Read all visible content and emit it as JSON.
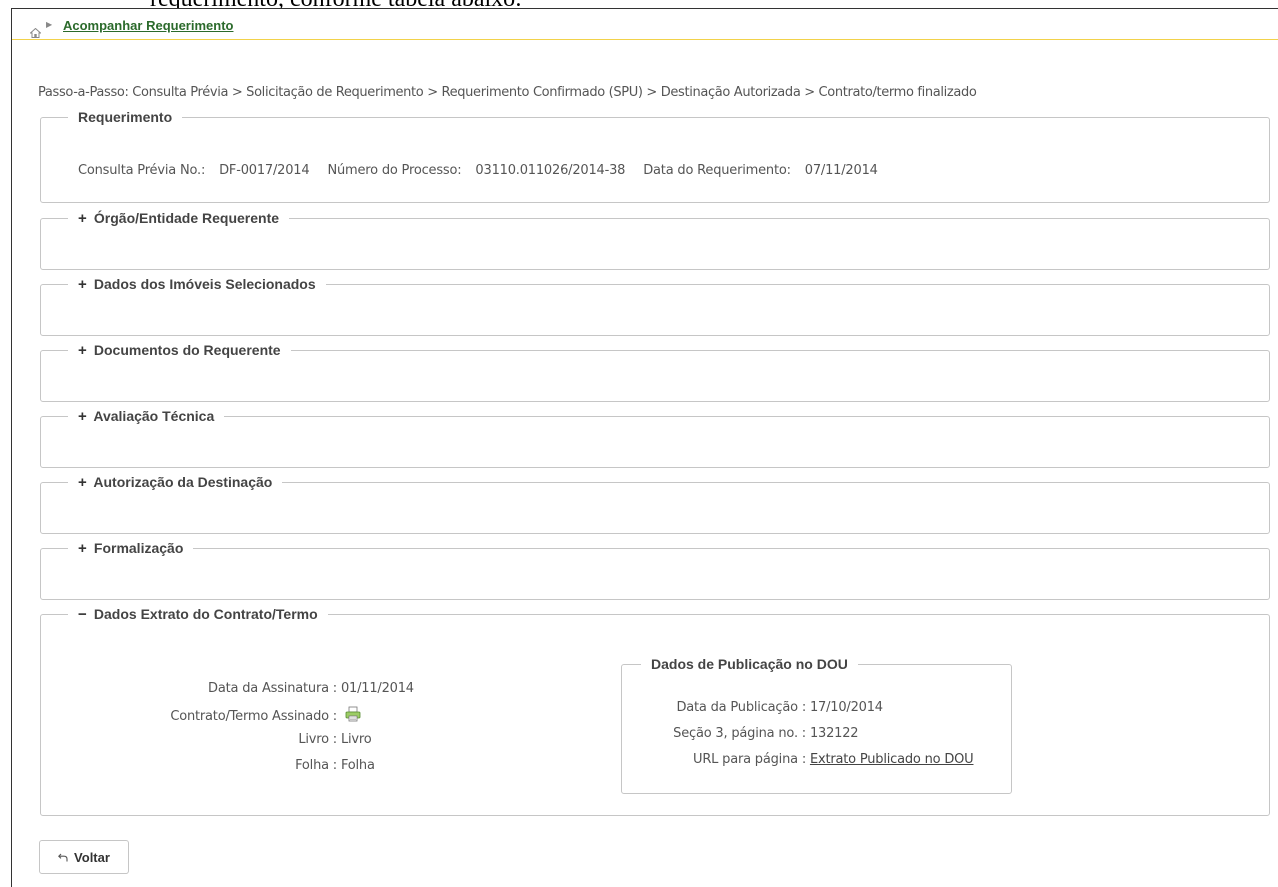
{
  "clipped_text": "requerimento, conforme tabela abaixo:",
  "breadcrumb": {
    "link": "Acompanhar Requerimento"
  },
  "steps": "Passo-a-Passo: Consulta Prévia > Solicitação de Requerimento > Requerimento Confirmado (SPU) > Destinação Autorizada > Contrato/termo finalizado",
  "requerimento": {
    "title": "Requerimento",
    "consulta_label": "Consulta Prévia No.:",
    "consulta_value": "DF-0017/2014",
    "processo_label": "Número do Processo:",
    "processo_value": "03110.011026/2014-38",
    "data_label": "Data do Requerimento:",
    "data_value": "07/11/2014"
  },
  "sections": {
    "orgao": "Órgão/Entidade Requerente",
    "imoveis": "Dados dos Imóveis Selecionados",
    "documentos": "Documentos do Requerente",
    "avaliacao": "Avaliação Técnica",
    "autorizacao": "Autorização da Destinação",
    "formalizacao": "Formalização",
    "extrato": "Dados Extrato do Contrato/Termo"
  },
  "extrato": {
    "assinatura_label": "Data da Assinatura :",
    "assinatura_value": "01/11/2014",
    "contrato_label": "Contrato/Termo Assinado :",
    "livro_label": "Livro :",
    "livro_value": "Livro",
    "folha_label": "Folha :",
    "folha_value": "Folha"
  },
  "dou": {
    "title": "Dados de Publicação no DOU",
    "data_label": "Data da Publicação :",
    "data_value": "17/10/2014",
    "secao_label": "Seção 3, página no. :",
    "secao_value": "132122",
    "url_label": "URL para página :",
    "url_value": "Extrato Publicado no DOU"
  },
  "buttons": {
    "voltar": "Voltar"
  }
}
